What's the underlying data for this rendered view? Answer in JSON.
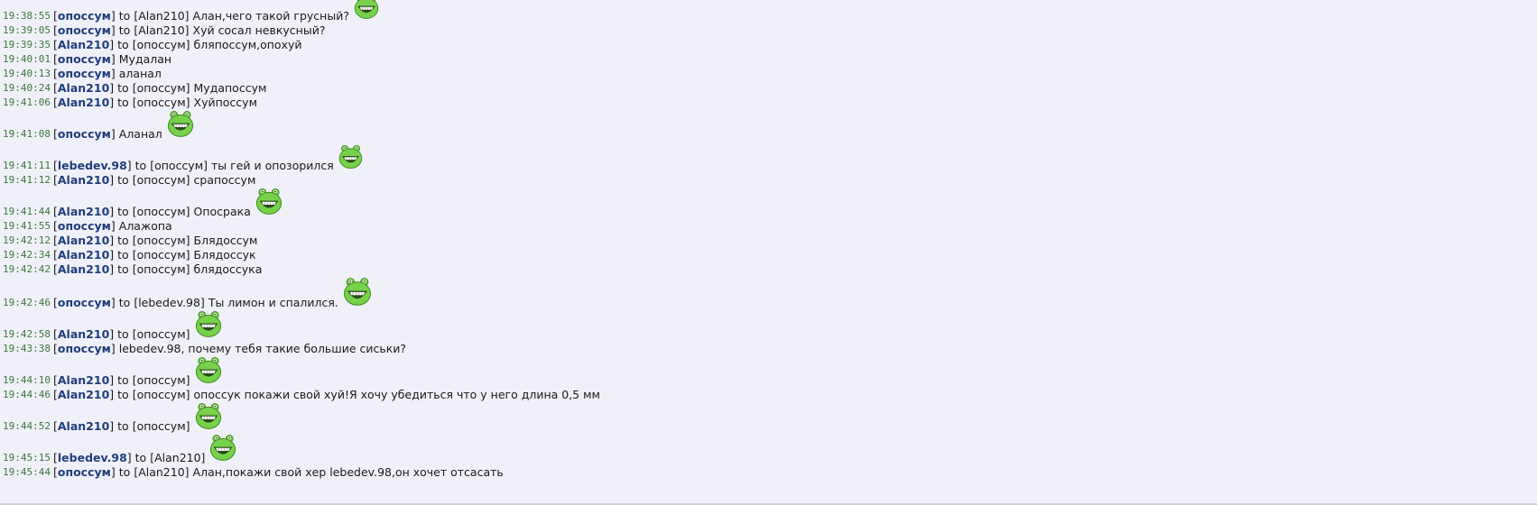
{
  "rows": [
    {
      "time": "19:38:55",
      "from": "опоссум",
      "to": "Alan210",
      "text": "Алан,чего такой грусный?",
      "smiley": "laughing-frog-smiley"
    },
    {
      "time": "19:39:05",
      "from": "опоссум",
      "to": "Alan210",
      "text": "Хуй сосал невкусный?"
    },
    {
      "time": "19:39:35",
      "from": "Alan210",
      "to": "опоссум",
      "text": "бляпоссум,опохуй"
    },
    {
      "time": "19:40:01",
      "from": "опоссум",
      "text": "Мудалан"
    },
    {
      "time": "19:40:13",
      "from": "опоссум",
      "text": "аланал"
    },
    {
      "time": "19:40:24",
      "from": "Alan210",
      "to": "опоссум",
      "text": "Мудапоссум"
    },
    {
      "time": "19:41:06",
      "from": "Alan210",
      "to": "опоссум",
      "text": "Хуйпоссум"
    },
    {
      "time": "19:41:08",
      "from": "опоссум",
      "text": "Аланал",
      "smiley": "laughing-frog-smiley"
    },
    {
      "time": "19:41:11",
      "from": "lebedev.98",
      "to": "опоссум",
      "text": "ты гей и опозорился",
      "smiley": "laughing-frog-smiley"
    },
    {
      "time": "19:41:12",
      "from": "Alan210",
      "to": "опоссум",
      "text": "срапоссум"
    },
    {
      "time": "19:41:44",
      "from": "Alan210",
      "to": "опоссум",
      "text": "Опосрака",
      "smiley": "laughing-frog-smiley"
    },
    {
      "time": "19:41:55",
      "from": "опоссум",
      "text": "Алажопа"
    },
    {
      "time": "19:42:12",
      "from": "Alan210",
      "to": "опоссум",
      "text": "Блядоссум"
    },
    {
      "time": "19:42:34",
      "from": "Alan210",
      "to": "опоссум",
      "text": "Блядоссук"
    },
    {
      "time": "19:42:42",
      "from": "Alan210",
      "to": "опоссум",
      "text": "блядоссука"
    },
    {
      "time": "19:42:46",
      "from": "опоссум",
      "to": "lebedev.98",
      "text": "Ты лимон и спалился.",
      "smiley": "laughing-frog-smiley"
    },
    {
      "time": "19:42:58",
      "from": "Alan210",
      "to": "опоссум",
      "text": "",
      "smiley": "laughing-frog-smiley"
    },
    {
      "time": "19:43:38",
      "from": "опоссум",
      "text": "lebedev.98, почему тебя такие большие сиськи?"
    },
    {
      "time": "19:44:10",
      "from": "Alan210",
      "to": "опоссум",
      "text": "",
      "smiley": "laughing-frog-smiley"
    },
    {
      "time": "19:44:46",
      "from": "Alan210",
      "to": "опоссум",
      "text": "опоссук покажи свой хуй!Я хочу убедиться что у него длина 0,5 мм"
    },
    {
      "time": "19:44:52",
      "from": "Alan210",
      "to": "опоссум",
      "text": "",
      "smiley": "laughing-frog-smiley"
    },
    {
      "time": "19:45:15",
      "from": "lebedev.98",
      "to": "Alan210",
      "text": "",
      "smiley": "laughing-frog-smiley"
    },
    {
      "time": "19:45:44",
      "from": "опоссум",
      "to": "Alan210",
      "text": "Алан,покажи свой хер lebedev.98,он хочет отсасать"
    }
  ],
  "to_word": "to",
  "colors": {
    "background": "#f0f0f9",
    "nick": "#1f3f7a",
    "time": "#3a7a3a",
    "smiley": "#77d14a"
  }
}
